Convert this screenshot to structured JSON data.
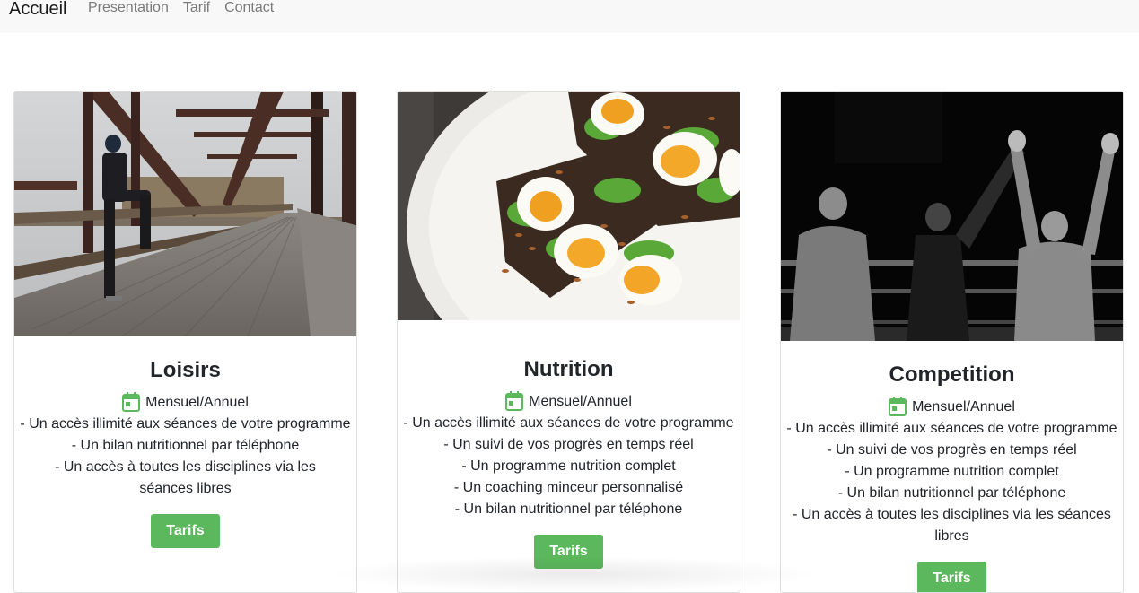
{
  "nav": {
    "brand": "Accueil",
    "links": [
      "Presentation",
      "Tarif",
      "Contact"
    ]
  },
  "colors": {
    "accent": "#5cb85c",
    "navbar_bg": "#f8f8f8"
  },
  "cards": [
    {
      "title": "Loisirs",
      "image": "person-stretching-on-bridge-photo",
      "plan": "Mensuel/Annuel",
      "features": [
        "- Un accès illimité aux séances de votre programme",
        "- Un bilan nutritionnel par téléphone",
        "- Un accès à toutes les disciplines via les séances libres"
      ],
      "button": "Tarifs"
    },
    {
      "title": "Nutrition",
      "image": "avocado-egg-toast-photo",
      "plan": "Mensuel/Annuel",
      "features": [
        "- Un accès illimité aux séances de votre programme",
        "- Un suivi de vos progrès en temps réel",
        "- Un programme nutrition complet",
        "- Un coaching minceur personnalisé",
        "- Un bilan nutritionnel par téléphone"
      ],
      "button": "Tarifs"
    },
    {
      "title": "Competition",
      "image": "boxing-ring-winner-photo",
      "plan": "Mensuel/Annuel",
      "features": [
        "- Un accès illimité aux séances de votre programme",
        "- Un suivi de vos progrès en temps réel",
        "- Un programme nutrition complet",
        "- Un bilan nutritionnel par téléphone",
        "- Un accès à toutes les disciplines via les séances libres"
      ],
      "button": "Tarifs"
    }
  ]
}
